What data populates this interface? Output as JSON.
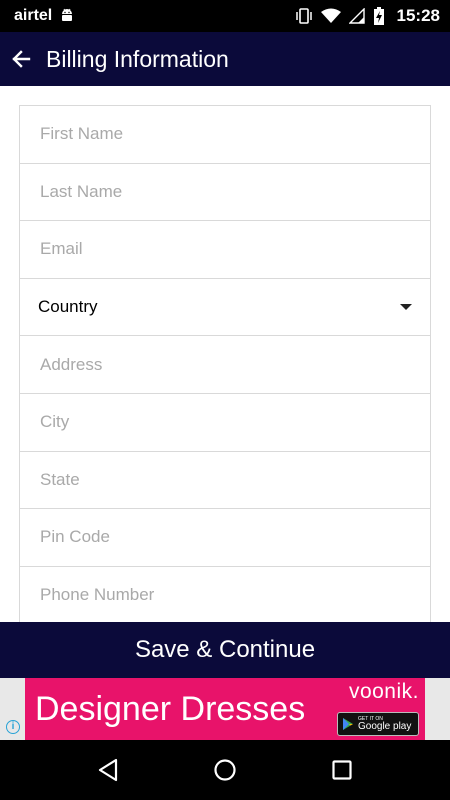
{
  "status_bar": {
    "carrier": "airtel",
    "time": "15:28",
    "icons": [
      "android-icon",
      "vibrate-icon",
      "wifi-icon",
      "signal-icon",
      "battery-icon"
    ]
  },
  "app_bar": {
    "title": "Billing Information",
    "back_icon": "arrow-left-icon"
  },
  "form": {
    "fields": [
      {
        "name": "first-name-field",
        "placeholder": "First Name",
        "value": ""
      },
      {
        "name": "last-name-field",
        "placeholder": "Last Name",
        "value": ""
      },
      {
        "name": "email-field",
        "placeholder": "Email",
        "value": ""
      },
      {
        "name": "country-select",
        "type": "select",
        "value": "Country"
      },
      {
        "name": "address-field",
        "placeholder": "Address",
        "value": ""
      },
      {
        "name": "city-field",
        "placeholder": "City",
        "value": ""
      },
      {
        "name": "state-field",
        "placeholder": "State",
        "value": ""
      },
      {
        "name": "pin-code-field",
        "placeholder": "Pin Code",
        "value": ""
      },
      {
        "name": "phone-number-field",
        "placeholder": "Phone Number",
        "value": ""
      }
    ]
  },
  "save_button": {
    "label": "Save & Continue"
  },
  "ad": {
    "headline": "Designer Dresses",
    "brand": "voonik.",
    "store_small": "GET IT ON",
    "store_big": "Google play"
  },
  "nav_bar": {
    "icons": [
      "back-triangle-icon",
      "home-circle-icon",
      "recents-square-icon"
    ]
  },
  "colors": {
    "primary": "#0b0a3a",
    "ad_background": "#e8136a",
    "placeholder": "#a9a9a9",
    "divider": "#d9d9d9"
  }
}
